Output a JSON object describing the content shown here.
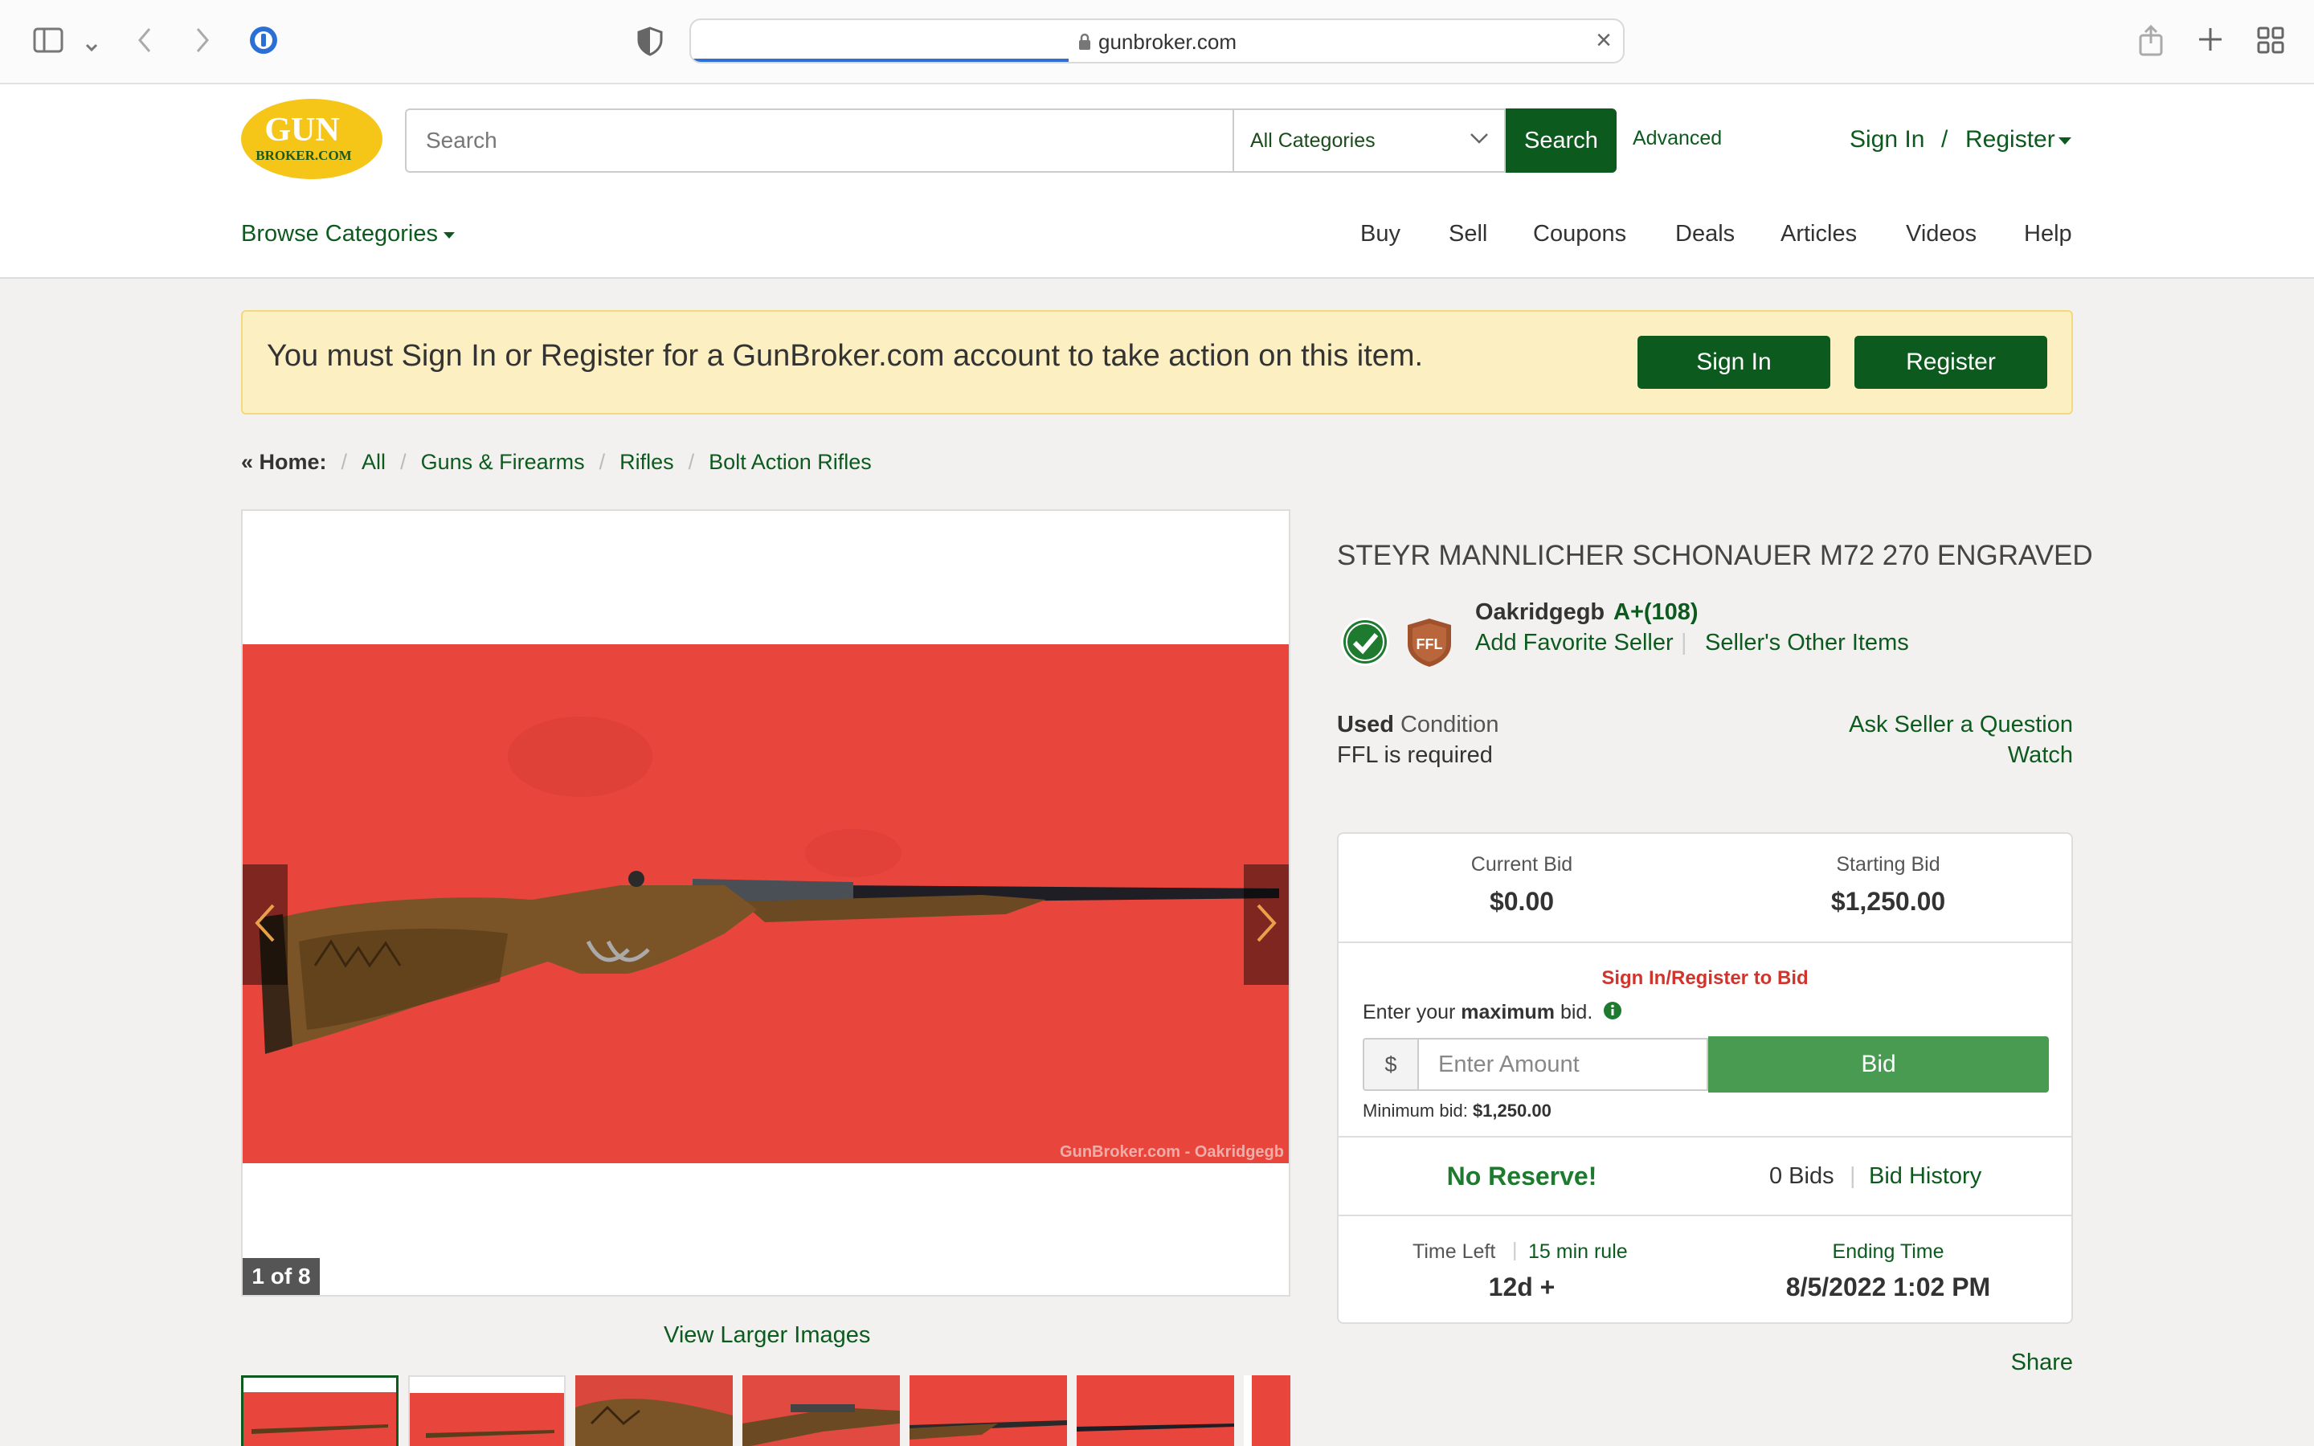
{
  "browser": {
    "url": "gunbroker.com"
  },
  "header": {
    "logo_top": "GUN",
    "logo_bottom": "BROKER.COM",
    "search_placeholder": "Search",
    "category_selected": "All Categories",
    "search_button": "Search",
    "advanced_link": "Advanced",
    "sign_in": "Sign In",
    "slash": "/",
    "register": "Register",
    "browse_categories": "Browse Categories",
    "nav": [
      "Buy",
      "Sell",
      "Coupons",
      "Deals",
      "Articles",
      "Videos",
      "Help"
    ]
  },
  "banner": {
    "message": "You must Sign In or Register for a GunBroker.com account to take action on this item.",
    "sign_in_button": "Sign In",
    "register_button": "Register"
  },
  "breadcrumb": {
    "home": "« Home:",
    "items": [
      "All",
      "Guns & Firearms",
      "Rifles",
      "Bolt Action Rifles"
    ]
  },
  "gallery": {
    "watermark": "GunBroker.com - Oakridgegb",
    "counter": "1 of 8",
    "view_larger": "View Larger Images",
    "photo_background": "#e8453c"
  },
  "item": {
    "title": "STEYR MANNLICHER SCHONAUER M72 270 ENGRAVED",
    "seller_name": "Oakridgegb",
    "seller_rating": "A+(108)",
    "add_favorite": "Add Favorite Seller",
    "other_items": "Seller's Other Items",
    "ffl_badge": "FFL",
    "condition_value": "Used",
    "condition_label": "Condition",
    "ffl_required": "FFL is required",
    "ask_seller": "Ask Seller a Question",
    "watch": "Watch"
  },
  "bid": {
    "current_bid_label": "Current Bid",
    "current_bid": "$0.00",
    "starting_bid_label": "Starting Bid",
    "starting_bid": "$1,250.00",
    "signin_to_bid": "Sign In/Register to Bid",
    "enter_prefix": "Enter your",
    "enter_strong": "maximum",
    "enter_suffix": "bid.",
    "currency_symbol": "$",
    "amount_placeholder": "Enter Amount",
    "bid_button": "Bid",
    "min_bid_label": "Minimum bid:",
    "min_bid": "$1,250.00",
    "no_reserve": "No Reserve!",
    "bids_count": "0 Bids",
    "bid_history": "Bid History",
    "time_left_label": "Time Left",
    "rule": "15 min rule",
    "time_left": "12d +",
    "ending_time_label": "Ending Time",
    "ending_time": "8/5/2022 1:02 PM"
  },
  "share": "Share",
  "colors": {
    "brand_green": "#0d5a1e",
    "bid_green": "#4a9b52",
    "banner_bg": "#fcefc2",
    "logo_yellow": "#f5c518",
    "alert_red": "#d0342c"
  }
}
